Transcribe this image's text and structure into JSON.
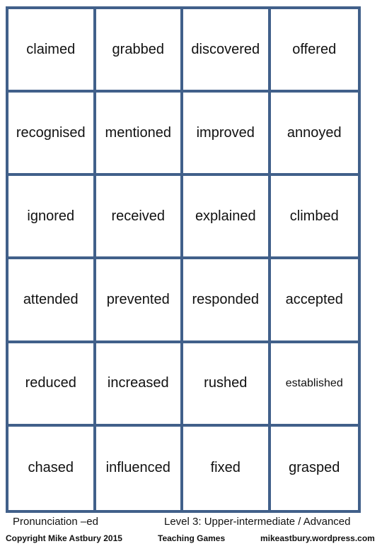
{
  "cards": [
    [
      "claimed",
      "grabbed",
      "discovered",
      "offered"
    ],
    [
      "recognised",
      "mentioned",
      "improved",
      "annoyed"
    ],
    [
      "ignored",
      "received",
      "explained",
      "climbed"
    ],
    [
      "attended",
      "prevented",
      "responded",
      "accepted"
    ],
    [
      "reduced",
      "increased",
      "rushed",
      "established"
    ],
    [
      "chased",
      "influenced",
      "fixed",
      "grasped"
    ]
  ],
  "footer": {
    "topic": "Pronunciation –ed",
    "level": "Level 3:  Upper-intermediate / Advanced",
    "copyright": "Copyright Mike Astbury 2015",
    "series": "Teaching Games",
    "website": "mikeastbury.wordpress.com"
  },
  "colors": {
    "grid_border": "#41608a"
  }
}
